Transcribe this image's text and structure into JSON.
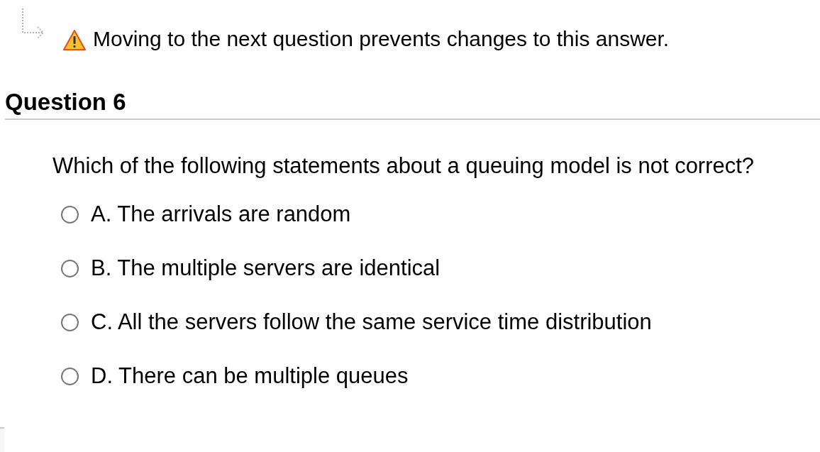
{
  "notice": {
    "text": "Moving to the next question prevents changes to this answer."
  },
  "question": {
    "title": "Question 6",
    "prompt": "Which of the following statements about a queuing model is not correct?",
    "options": [
      {
        "label": "A. The arrivals are random",
        "selected": false
      },
      {
        "label": "B. The multiple servers are identical",
        "selected": false
      },
      {
        "label": "C. All the servers follow the same service time distribution",
        "selected": false
      },
      {
        "label": "D. There can be multiple queues",
        "selected": false
      }
    ]
  }
}
